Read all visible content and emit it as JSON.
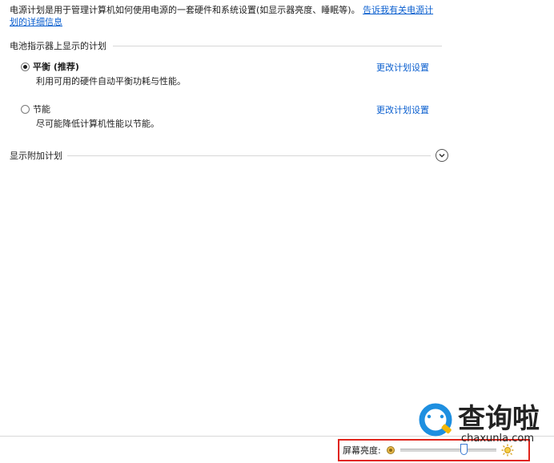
{
  "intro": {
    "text": "电源计划是用于管理计算机如何使用电源的一套硬件和系统设置(如显示器亮度、睡眠等)。",
    "link_line1": "告诉我有关电源计",
    "link_line2": "划的详细信息"
  },
  "battery_section": {
    "title": "电池指示器上显示的计划"
  },
  "plans": [
    {
      "name": "平衡 (推荐)",
      "description": "利用可用的硬件自动平衡功耗与性能。",
      "selected": true,
      "change_label": "更改计划设置"
    },
    {
      "name": "节能",
      "description": "尽可能降低计算机性能以节能。",
      "selected": false,
      "change_label": "更改计划设置"
    }
  ],
  "extra_plans": {
    "label": "显示附加计划"
  },
  "brightness": {
    "label": "屏幕亮度:",
    "level_percent": 68
  },
  "watermark": {
    "brand": "查询啦",
    "site": "chaxunla.com"
  },
  "colors": {
    "link": "#0b5fcf",
    "highlight_border": "#e0241b",
    "watermark_blue": "#1e8fe0",
    "watermark_yellow": "#f2b705"
  }
}
